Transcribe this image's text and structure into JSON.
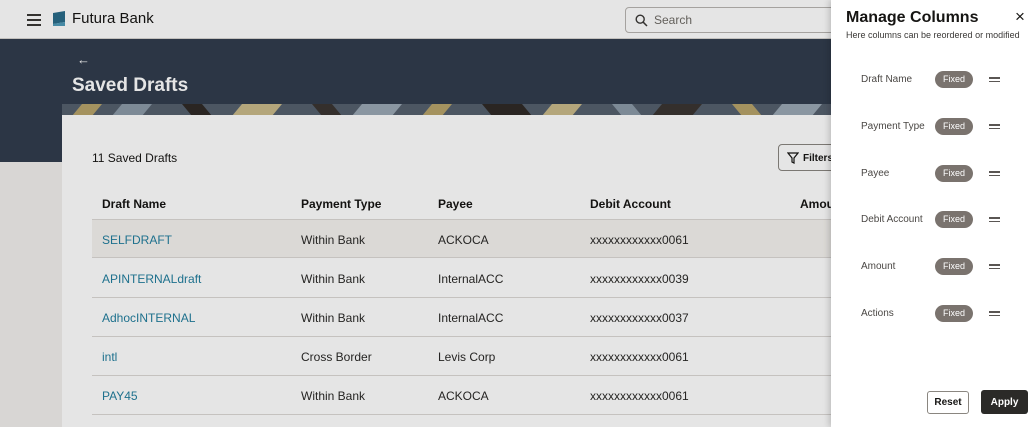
{
  "app": {
    "brand": "Futura Bank"
  },
  "search": {
    "placeholder": "Search"
  },
  "page": {
    "back_glyph": "←",
    "title": "Saved Drafts"
  },
  "list": {
    "count_label": "11 Saved Drafts",
    "filters_label": "Filters",
    "columns": [
      "Draft Name",
      "Payment Type",
      "Payee",
      "Debit Account",
      "Amour"
    ],
    "rows": [
      {
        "draft_name": "SELFDRAFT",
        "payment_type": "Within Bank",
        "payee": "ACKOCA",
        "debit_account": "xxxxxxxxxxxx0061"
      },
      {
        "draft_name": "APINTERNALdraft",
        "payment_type": "Within Bank",
        "payee": "InternalACC",
        "debit_account": "xxxxxxxxxxxx0039"
      },
      {
        "draft_name": "AdhocINTERNAL",
        "payment_type": "Within Bank",
        "payee": "InternalACC",
        "debit_account": "xxxxxxxxxxxx0037"
      },
      {
        "draft_name": "intl",
        "payment_type": "Cross Border",
        "payee": "Levis Corp",
        "debit_account": "xxxxxxxxxxxx0061"
      },
      {
        "draft_name": "PAY45",
        "payment_type": "Within Bank",
        "payee": "ACKOCA",
        "debit_account": "xxxxxxxxxxxx0061"
      }
    ]
  },
  "panel": {
    "title": "Manage Columns",
    "subtitle": "Here columns can be reordered or modified",
    "close_glyph": "×",
    "columns": [
      {
        "name": "Draft Name",
        "badge": "Fixed"
      },
      {
        "name": "Payment Type",
        "badge": "Fixed"
      },
      {
        "name": "Payee",
        "badge": "Fixed"
      },
      {
        "name": "Debit Account",
        "badge": "Fixed"
      },
      {
        "name": "Amount",
        "badge": "Fixed"
      },
      {
        "name": "Actions",
        "badge": "Fixed"
      }
    ],
    "reset_label": "Reset",
    "apply_label": "Apply"
  },
  "icons": {
    "menu": "hamburger-icon",
    "logo": "bank-logo-icon",
    "search": "search-icon",
    "filter": "filter-icon",
    "back": "back-arrow-icon",
    "close": "close-icon",
    "drag": "drag-handle-icon"
  },
  "colors": {
    "header_band": "#323d4d",
    "link": "#227e9e",
    "badge": "#7a736e",
    "apply_button": "#2b2a28",
    "logo": "#2a6b8a"
  }
}
